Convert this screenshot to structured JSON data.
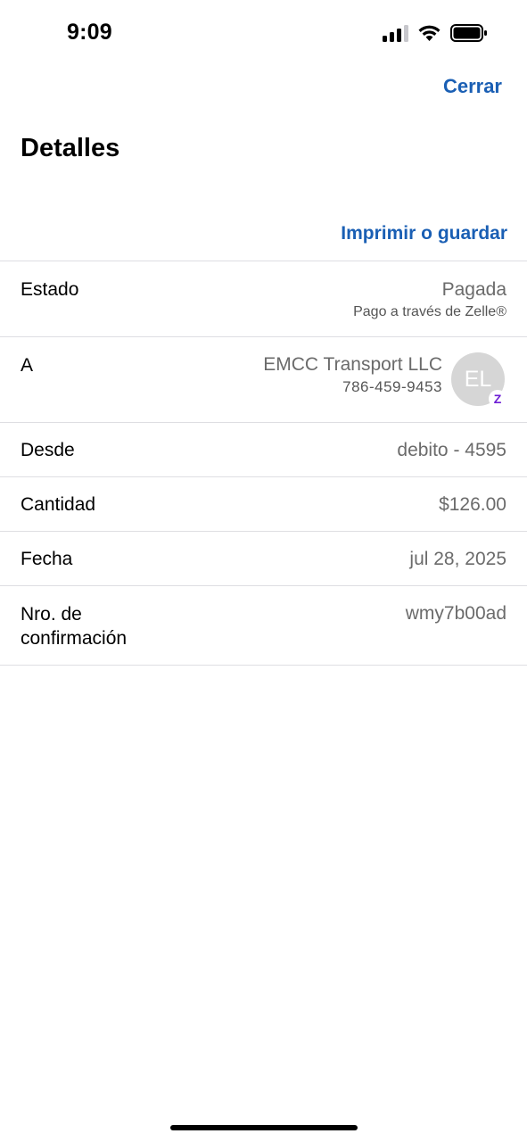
{
  "status_bar": {
    "time": "9:09",
    "icons": [
      "cellular-signal-icon",
      "wifi-icon",
      "battery-icon"
    ]
  },
  "nav": {
    "close_label": "Cerrar"
  },
  "page": {
    "title": "Detalles",
    "print_label": "Imprimir o guardar"
  },
  "details": {
    "status": {
      "label": "Estado",
      "value": "Pagada",
      "sub": "Pago a través de Zelle®"
    },
    "recipient": {
      "label": "A",
      "name": "EMCC Transport LLC",
      "phone": "786-459-9453",
      "avatar_initials": "EL",
      "badge": "Z"
    },
    "from": {
      "label": "Desde",
      "value": "debito - 4595"
    },
    "amount": {
      "label": "Cantidad",
      "value": "$126.00"
    },
    "date": {
      "label": "Fecha",
      "value": "jul 28, 2025"
    },
    "confirmation": {
      "label_line1": "Nro. de",
      "label_line2": "confirmación",
      "value": "wmy7b00ad"
    }
  },
  "colors": {
    "accent": "#1a5fb4",
    "zelle_purple": "#6d1ed4",
    "value_text": "#6b6b6b",
    "divider": "#dedee2"
  }
}
